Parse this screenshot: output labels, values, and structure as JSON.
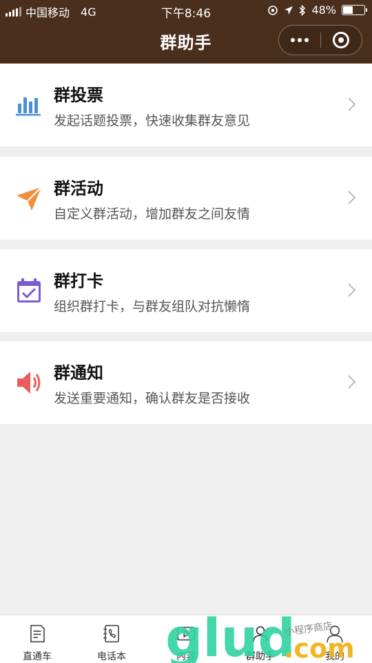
{
  "status_bar": {
    "carrier": "中国移动",
    "network": "4G",
    "time": "下午8:46",
    "battery_percent": "48%",
    "battery_level": 0.48
  },
  "nav": {
    "title": "群助手"
  },
  "items": [
    {
      "title": "群投票",
      "desc": "发起话题投票，快速收集群友意见",
      "icon": "bar-chart-icon",
      "color": "#4a8fd8"
    },
    {
      "title": "群活动",
      "desc": "自定义群活动，增加群友之间友情",
      "icon": "paper-plane-icon",
      "color": "#f0913a"
    },
    {
      "title": "群打卡",
      "desc": "组织群打卡，与群友组队对抗懒惰",
      "icon": "calendar-check-icon",
      "color": "#7a5bd6"
    },
    {
      "title": "群通知",
      "desc": "发送重要通知，确认群友是否接收",
      "icon": "speaker-icon",
      "color": "#ea5d5d"
    }
  ],
  "tabs": [
    {
      "label": "直通车",
      "icon": "document-icon"
    },
    {
      "label": "电话本",
      "icon": "phonebook-icon"
    },
    {
      "label": "内容",
      "icon": "video-icon"
    },
    {
      "label": "群助手",
      "icon": "group-icon",
      "active": true
    },
    {
      "label": "我的",
      "icon": "person-icon"
    }
  ],
  "watermark": {
    "brand": "glud",
    "suffix": ".com",
    "tagline": "小程序商店"
  }
}
